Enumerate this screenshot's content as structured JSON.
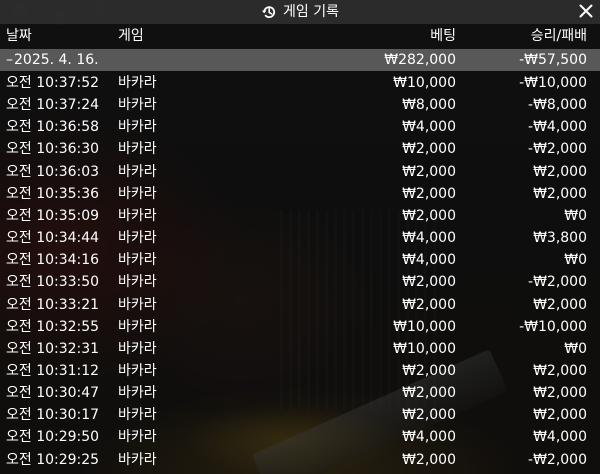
{
  "title": "게임 기록",
  "icons": {
    "title": "history-icon",
    "close": "close-icon"
  },
  "columns": {
    "date": "날짜",
    "game": "게임",
    "bet": "베팅",
    "result": "승리/패배"
  },
  "group": {
    "toggle": "–",
    "date": "2025. 4. 16.",
    "bet": "₩282,000",
    "result": "-₩57,500"
  },
  "rows": [
    {
      "time": "오전 10:37:52",
      "game": "바카라",
      "bet": "₩10,000",
      "result": "-₩10,000"
    },
    {
      "time": "오전 10:37:24",
      "game": "바카라",
      "bet": "₩8,000",
      "result": "-₩8,000"
    },
    {
      "time": "오전 10:36:58",
      "game": "바카라",
      "bet": "₩4,000",
      "result": "-₩4,000"
    },
    {
      "time": "오전 10:36:30",
      "game": "바카라",
      "bet": "₩2,000",
      "result": "-₩2,000"
    },
    {
      "time": "오전 10:36:03",
      "game": "바카라",
      "bet": "₩2,000",
      "result": "₩2,000"
    },
    {
      "time": "오전 10:35:36",
      "game": "바카라",
      "bet": "₩2,000",
      "result": "₩2,000"
    },
    {
      "time": "오전 10:35:09",
      "game": "바카라",
      "bet": "₩2,000",
      "result": "₩0"
    },
    {
      "time": "오전 10:34:44",
      "game": "바카라",
      "bet": "₩4,000",
      "result": "₩3,800"
    },
    {
      "time": "오전 10:34:16",
      "game": "바카라",
      "bet": "₩4,000",
      "result": "₩0"
    },
    {
      "time": "오전 10:33:50",
      "game": "바카라",
      "bet": "₩2,000",
      "result": "-₩2,000"
    },
    {
      "time": "오전 10:33:21",
      "game": "바카라",
      "bet": "₩2,000",
      "result": "₩2,000"
    },
    {
      "time": "오전 10:32:55",
      "game": "바카라",
      "bet": "₩10,000",
      "result": "-₩10,000"
    },
    {
      "time": "오전 10:32:31",
      "game": "바카라",
      "bet": "₩10,000",
      "result": "₩0"
    },
    {
      "time": "오전 10:31:12",
      "game": "바카라",
      "bet": "₩2,000",
      "result": "₩2,000"
    },
    {
      "time": "오전 10:30:47",
      "game": "바카라",
      "bet": "₩2,000",
      "result": "₩2,000"
    },
    {
      "time": "오전 10:30:17",
      "game": "바카라",
      "bet": "₩2,000",
      "result": "₩2,000"
    },
    {
      "time": "오전 10:29:50",
      "game": "바카라",
      "bet": "₩4,000",
      "result": "₩4,000"
    },
    {
      "time": "오전 10:29:25",
      "game": "바카라",
      "bet": "₩2,000",
      "result": "-₩2,000"
    }
  ]
}
